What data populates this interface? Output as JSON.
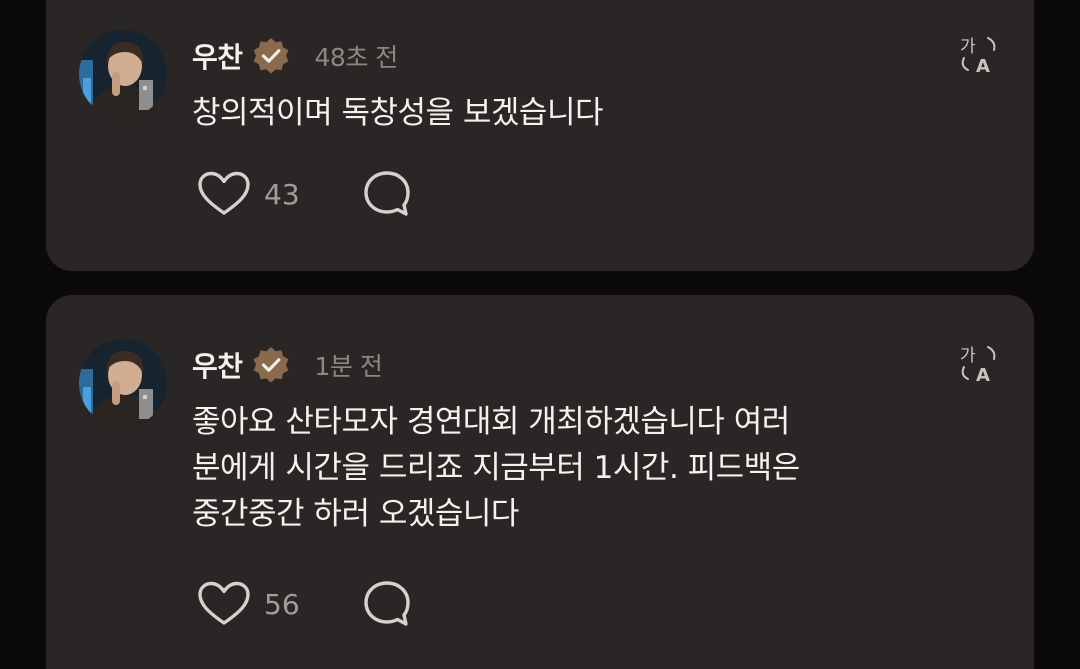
{
  "comments": [
    {
      "username": "우찬",
      "verified": true,
      "timestamp": "48초 전",
      "text": "창의적이며 독창성을 보겠습니다",
      "likes": "43"
    },
    {
      "username": "우찬",
      "verified": true,
      "timestamp": "1분 전",
      "text": "좋아요 산타모자 경연대회 개최하겠습니다 여러\n분에게 시간을 드리죠 지금부터 1시간. 피드백은\n중간중간 하러 오겠습니다",
      "likes": "56"
    }
  ],
  "icons": {
    "verified": "verified-badge-icon",
    "translate": "translate-icon",
    "like": "heart-icon",
    "reply": "speech-bubble-icon"
  },
  "colors": {
    "background": "#0b0a09",
    "card": "#2a2625",
    "text": "#f4f1ee",
    "muted": "#8d8784",
    "badge": "#8a6a4c"
  }
}
